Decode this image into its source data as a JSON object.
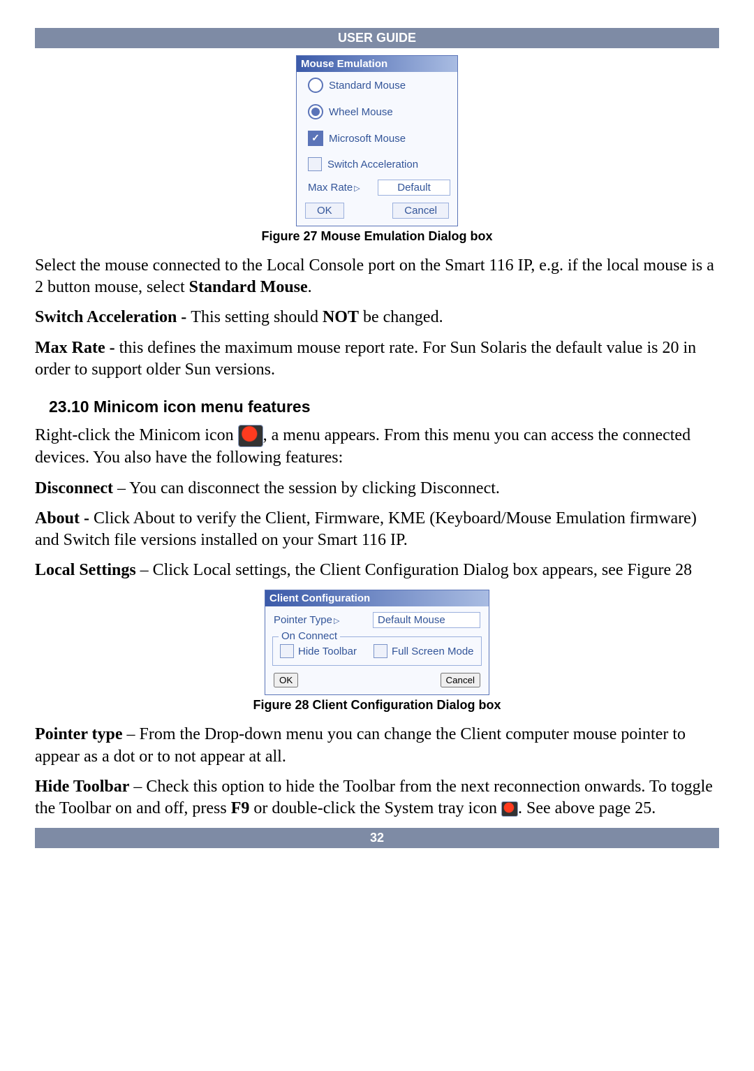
{
  "header": {
    "title": "USER GUIDE"
  },
  "footer": {
    "page": "32"
  },
  "dialog_mouse": {
    "title": "Mouse Emulation",
    "opt1": "Standard Mouse",
    "opt2": "Wheel Mouse",
    "opt3": "Microsoft Mouse",
    "opt4": "Switch Acceleration",
    "maxrate_label": "Max Rate",
    "maxrate_value": "Default",
    "ok": "OK",
    "cancel": "Cancel"
  },
  "fig27": "Figure 27 Mouse Emulation Dialog box",
  "p1_a": "Select the mouse connected to the Local Console port on the Smart 116 IP, e.g. if the local mouse is a 2 button mouse, select ",
  "p1_b": "Standard Mouse",
  "p1_c": ".",
  "p2_a": "Switch Acceleration - ",
  "p2_b": "This setting should ",
  "p2_c": "NOT",
  "p2_d": " be changed.",
  "p3_a": "Max Rate - ",
  "p3_b": "this defines the maximum mouse report rate. For Sun Solaris the default value is 20 in order to support older Sun versions.",
  "section": "23.10 Minicom icon menu features",
  "p4_a": "Right-click the Minicom icon ",
  "p4_b": ", a menu appears. From this menu you can access the connected devices. You also have the following features:",
  "p5_a": "Disconnect",
  "p5_b": " – You can disconnect the session by clicking Disconnect.",
  "p6_a": "About - ",
  "p6_b": "Click About to verify the Client, Firmware, KME (Keyboard/Mouse Emulation firmware) and Switch file versions installed on your Smart 116 IP.",
  "p7_a": "Local Settings",
  "p7_b": " – Click Local settings, the Client Configuration Dialog box appears, see Figure 28",
  "dialog_client": {
    "title": "Client Configuration",
    "ptr_label": "Pointer Type",
    "ptr_value": "Default Mouse",
    "onconnect_label": "On Connect",
    "hide_toolbar": "Hide Toolbar",
    "fullscreen": "Full Screen Mode",
    "ok": "OK",
    "cancel": "Cancel"
  },
  "fig28": "Figure 28 Client Configuration Dialog box",
  "p8_a": "Pointer type",
  "p8_b": " – From the Drop-down menu you can change the Client computer mouse pointer to appear as a dot or to not appear at all.",
  "p9_a": "Hide Toolbar",
  "p9_b": " – Check this option to hide the Toolbar from the next reconnection onwards. To toggle the Toolbar on and off, press ",
  "p9_c": "F9",
  "p9_d": " or double-click the System tray icon ",
  "p9_e": ". See above page 25."
}
